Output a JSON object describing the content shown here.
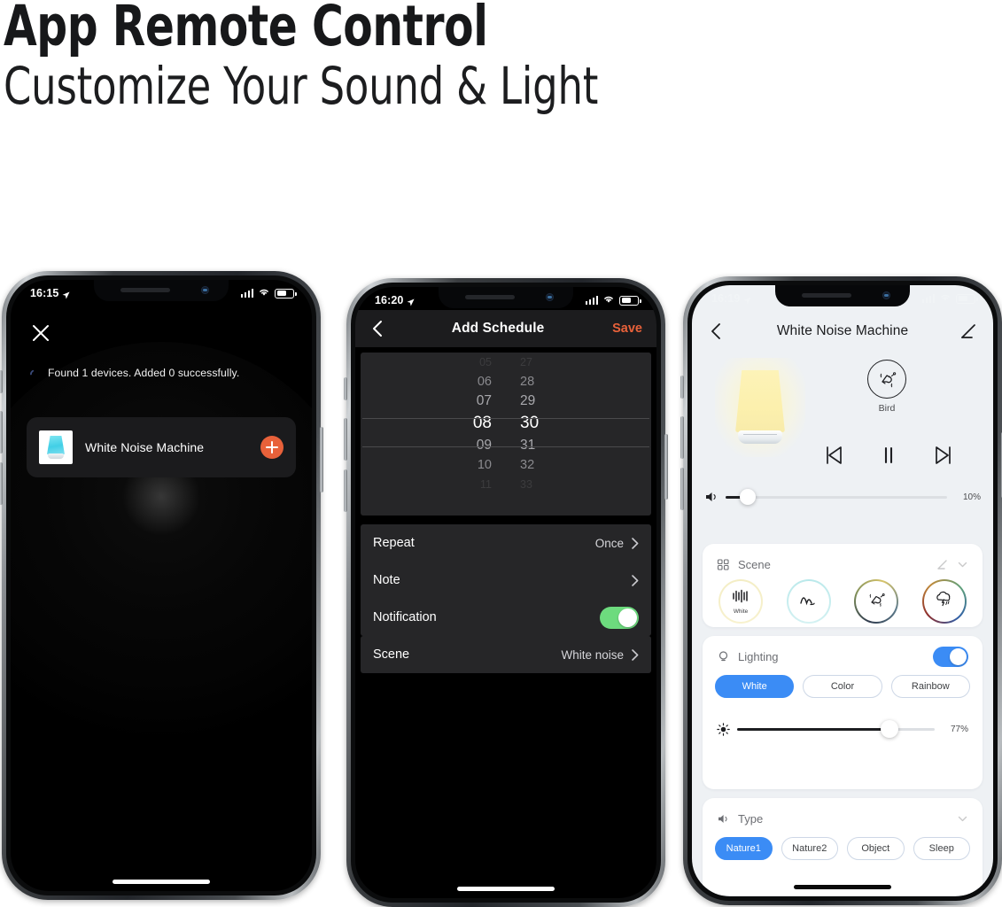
{
  "headings": {
    "line1": "App Remote Control",
    "line2": "Customize Your Sound & Light"
  },
  "colors": {
    "accent_orange": "#e8613a",
    "accent_blue": "#3b8cf5",
    "toggle_green": "#6ddb7e",
    "dark_bg": "#000000",
    "light_bg": "#eef1f4"
  },
  "phone1": {
    "status": {
      "time": "16:15",
      "location_icon": "location-arrow-icon",
      "signal_icon": "signal-bars-icon",
      "wifi_icon": "wifi-icon",
      "battery_icon": "battery-icon"
    },
    "close_icon": "close-icon",
    "status_message": "Found 1 devices. Added 0 successfully.",
    "spinner_icon": "spinner-icon",
    "device": {
      "thumbnail_icon": "white-noise-lamp-thumbnail",
      "name": "White Noise Machine",
      "add_icon": "plus-circle-icon"
    }
  },
  "phone2": {
    "status": {
      "time": "16:20",
      "location_icon": "location-arrow-icon",
      "signal_icon": "signal-bars-icon",
      "wifi_icon": "wifi-icon",
      "battery_icon": "battery-icon"
    },
    "nav": {
      "back_icon": "chevron-left-icon",
      "title": "Add Schedule",
      "save_label": "Save"
    },
    "time_picker": {
      "hours": [
        "05",
        "06",
        "07",
        "08",
        "09",
        "10",
        "11"
      ],
      "minutes": [
        "27",
        "28",
        "29",
        "30",
        "31",
        "32",
        "33"
      ],
      "selected_hour": "08",
      "selected_minute": "30"
    },
    "rows": [
      {
        "label": "Repeat",
        "value": "Once",
        "control": "chevron"
      },
      {
        "label": "Note",
        "value": "",
        "control": "chevron"
      },
      {
        "label": "Notification",
        "value": "",
        "control": "toggle-on"
      }
    ],
    "scene_row": {
      "label": "Scene",
      "value": "White noise",
      "control": "chevron"
    }
  },
  "phone3": {
    "status": {
      "time": "16:19",
      "location_icon": "location-arrow-icon",
      "signal_icon": "signal-bars-icon",
      "wifi_icon": "wifi-icon",
      "battery_icon": "battery-icon"
    },
    "nav": {
      "back_icon": "chevron-left-icon",
      "title": "White Noise Machine",
      "edit_icon": "pencil-icon"
    },
    "hero": {
      "lamp_icon": "glowing-lamp-image",
      "current_scene": "Bird",
      "current_scene_icon": "bird-icon"
    },
    "playback": {
      "prev_icon": "skip-previous-icon",
      "pause_icon": "pause-icon",
      "next_icon": "skip-next-icon"
    },
    "volume": {
      "icon": "speaker-icon",
      "percent": "10%",
      "value": 10
    },
    "scene_card": {
      "icon": "grid-icon",
      "title": "Scene",
      "edit_icon": "pencil-icon",
      "collapse_icon": "chevron-down-icon",
      "items": [
        {
          "name": "White",
          "icon": "sound-wave-icon",
          "label": "White"
        },
        {
          "name": "Wave",
          "icon": "wave-icon",
          "label": ""
        },
        {
          "name": "Bird",
          "icon": "bird-icon",
          "label": ""
        },
        {
          "name": "Thunder",
          "icon": "thunder-cloud-icon",
          "label": ""
        }
      ]
    },
    "lighting_card": {
      "icon": "bulb-icon",
      "title": "Lighting",
      "toggle": "on",
      "modes": [
        {
          "label": "White",
          "active": true
        },
        {
          "label": "Color",
          "active": false
        },
        {
          "label": "Rainbow",
          "active": false
        }
      ],
      "brightness": {
        "icon": "brightness-icon",
        "percent": "77%",
        "value": 77
      }
    },
    "type_card": {
      "icon": "speaker-icon",
      "title": "Type",
      "collapse_icon": "chevron-down-icon",
      "options": [
        {
          "label": "Nature1",
          "active": true
        },
        {
          "label": "Nature2",
          "active": false
        },
        {
          "label": "Object",
          "active": false
        },
        {
          "label": "Sleep",
          "active": false
        }
      ]
    }
  }
}
